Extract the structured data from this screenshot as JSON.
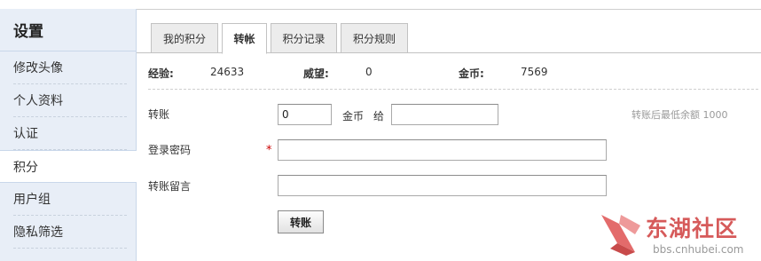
{
  "sidebar": {
    "title": "设置",
    "items": [
      {
        "label": "修改头像"
      },
      {
        "label": "个人资料"
      },
      {
        "label": "认证"
      },
      {
        "label": "积分"
      },
      {
        "label": "用户组"
      },
      {
        "label": "隐私筛选"
      }
    ]
  },
  "tabs": [
    {
      "label": "我的积分"
    },
    {
      "label": "转帐"
    },
    {
      "label": "积分记录"
    },
    {
      "label": "积分规则"
    }
  ],
  "stats": {
    "exp_label": "经验:",
    "exp_value": "24633",
    "prestige_label": "威望:",
    "prestige_value": "0",
    "coin_label": "金币:",
    "coin_value": "7569"
  },
  "form": {
    "transfer_label": "转账",
    "amount_value": "0",
    "unit_text": "金币",
    "to_text": "给",
    "recipient_value": "",
    "min_balance_hint": "转账后最低余额 1000",
    "password_label": "登录密码",
    "required_mark": "*",
    "password_value": "",
    "message_label": "转账留言",
    "message_value": "",
    "submit_label": "转账"
  },
  "watermark": {
    "brand": "东湖社区",
    "domain": "bbs.cnhubei.com"
  }
}
